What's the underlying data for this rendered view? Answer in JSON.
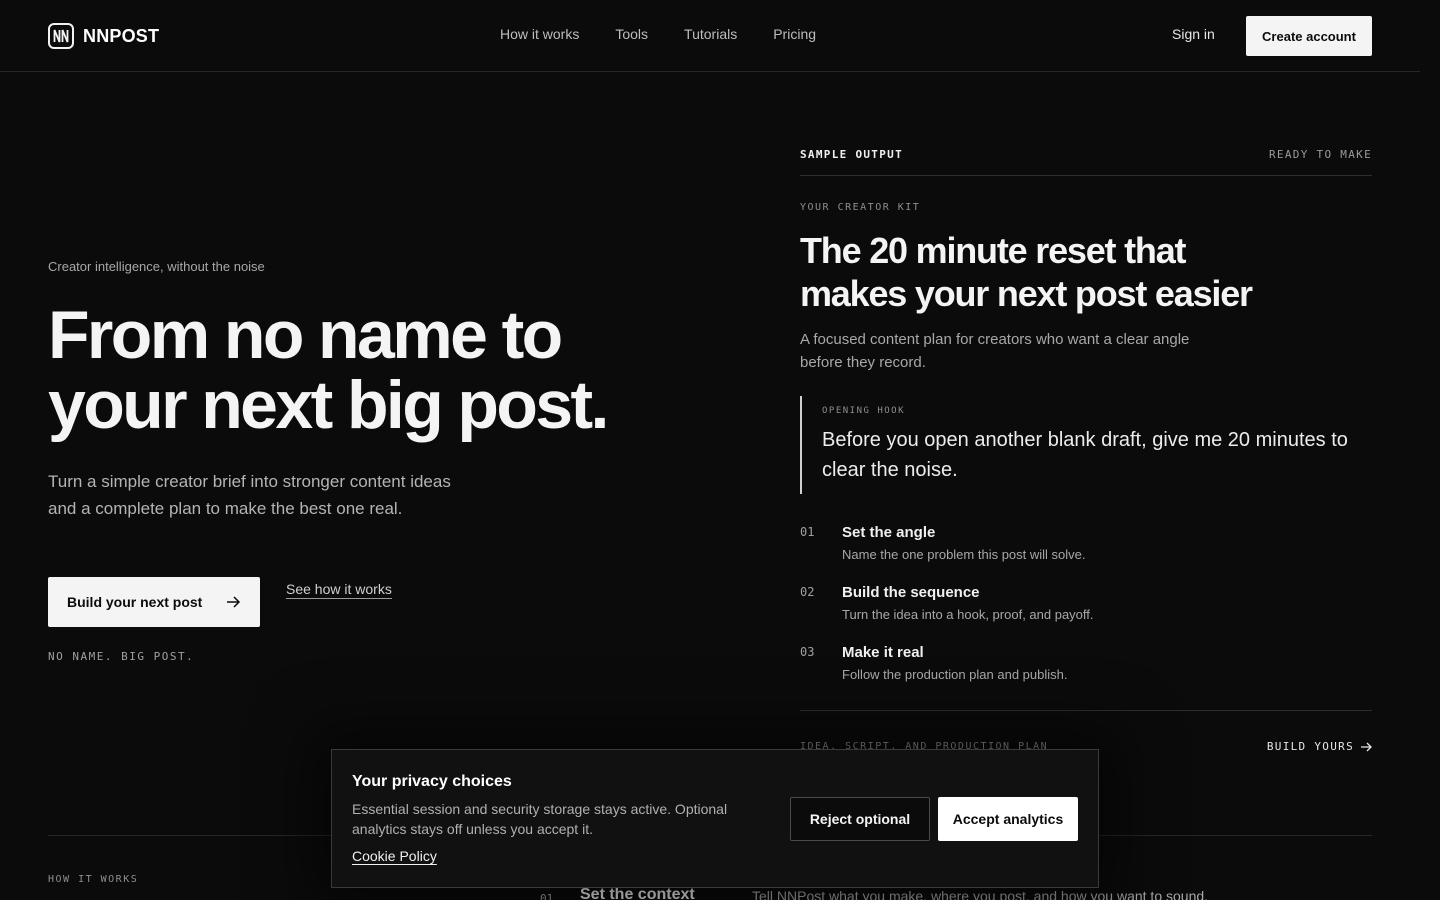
{
  "header": {
    "brand": "NNPOST",
    "logo_icon": "nn-logo-icon",
    "nav": [
      {
        "label": "How it works"
      },
      {
        "label": "Tools"
      },
      {
        "label": "Tutorials"
      },
      {
        "label": "Pricing"
      }
    ],
    "sign_in": "Sign in",
    "create_account": "Create account"
  },
  "hero": {
    "eyebrow": "Creator intelligence, without the noise",
    "title_line1": "From no name to",
    "title_line2": "your next big post.",
    "subtitle": "Turn a simple creator brief into stronger content ideas and a complete plan to make the best one real.",
    "primary_cta": "Build your next post",
    "secondary_cta": "See how it works",
    "tagline": "NO NAME. BIG POST."
  },
  "sample": {
    "label": "SAMPLE OUTPUT",
    "status": "READY TO MAKE",
    "kit_label": "YOUR CREATOR KIT",
    "title": "The 20 minute reset that makes your next post easier",
    "description": "A focused content plan for creators who want a clear angle before they record.",
    "hook_label": "OPENING HOOK",
    "hook_text": "Before you open another blank draft, give me 20 minutes to clear the noise.",
    "steps": [
      {
        "num": "01",
        "title": "Set the angle",
        "desc": "Name the one problem this post will solve."
      },
      {
        "num": "02",
        "title": "Build the sequence",
        "desc": "Turn the idea into a hook, proof, and payoff."
      },
      {
        "num": "03",
        "title": "Make it real",
        "desc": "Follow the production plan and publish."
      }
    ],
    "footer_left": "IDEA, SCRIPT, AND PRODUCTION PLAN",
    "footer_right": "BUILD YOURS"
  },
  "how_it_works": {
    "label": "HOW IT WORKS",
    "step_num": "01",
    "step_title": "Set the context",
    "step_desc": "Tell NNPost what you make, where you post, and how you want to sound."
  },
  "cookie": {
    "title": "Your privacy choices",
    "text": "Essential session and security storage stays active. Optional analytics stays off unless you accept it.",
    "link": "Cookie Policy",
    "reject": "Reject optional",
    "accept": "Accept analytics"
  },
  "colors": {
    "background": "#0b0b0b",
    "foreground": "#f4f4f4",
    "muted": "#a8a8a8",
    "border": "#262626"
  }
}
